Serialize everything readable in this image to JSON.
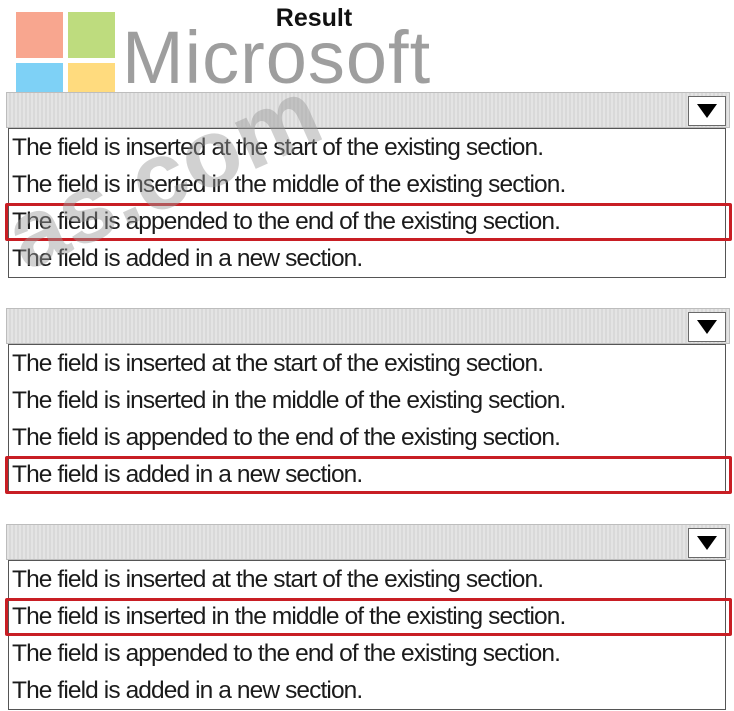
{
  "header": {
    "title": "Result"
  },
  "watermark": {
    "brand": "Microsoft",
    "overlay": "as.com",
    "logo_colors": [
      "#f25022",
      "#7fba00",
      "#00a4ef",
      "#ffb900"
    ]
  },
  "colors": {
    "selection_border": "#c81e24"
  },
  "dropdowns": [
    {
      "selected": "The field is appended to the end of the existing section.",
      "selected_index": 2,
      "arrow_icon": "chevron-down-icon",
      "options": [
        "The field is inserted at the start of the existing section.",
        "The field is inserted in the middle of the existing section.",
        "The field is appended to the end of the existing section.",
        "The field is added in a new section."
      ]
    },
    {
      "selected": "The field is added in a new section.",
      "selected_index": 3,
      "arrow_icon": "chevron-down-icon",
      "options": [
        "The field is inserted at the start of the existing section.",
        "The field is inserted in the middle of the existing section.",
        "The field is appended to the end of the existing section.",
        "The field is added in a new section."
      ]
    },
    {
      "selected": "The field is inserted in the middle of the existing section.",
      "selected_index": 1,
      "arrow_icon": "chevron-down-icon",
      "options": [
        "The field is inserted at the start of the existing section.",
        "The field is inserted in the middle of the existing section.",
        "The field is appended to the end of the existing section.",
        "The field is added in a new section."
      ]
    }
  ]
}
